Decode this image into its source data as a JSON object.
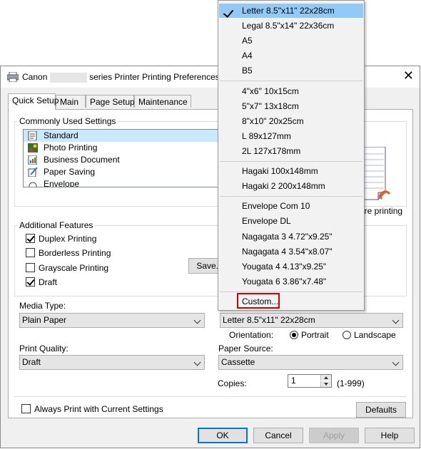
{
  "window": {
    "title_prefix": "Canon",
    "title_suffix": "series Printer Printing Preferences",
    "close": "✕"
  },
  "tabs": [
    "Quick Setup",
    "Main",
    "Page Setup",
    "Maintenance"
  ],
  "commonly_used": {
    "legend": "Commonly Used Settings",
    "items": [
      "Standard",
      "Photo Printing",
      "Business Document",
      "Paper Saving",
      "Envelope"
    ],
    "save_button": "Save..."
  },
  "preview": {
    "caption": "ore printing"
  },
  "additional": {
    "legend": "Additional Features",
    "items": [
      {
        "label": "Duplex Printing",
        "checked": true
      },
      {
        "label": "Borderless Printing",
        "checked": false
      },
      {
        "label": "Grayscale Printing",
        "checked": false
      },
      {
        "label": "Draft",
        "checked": true
      }
    ]
  },
  "media_type": {
    "label": "Media Type:",
    "value": "Plain Paper"
  },
  "page_size": {
    "value": "Letter 8.5\"x11\" 22x28cm"
  },
  "orientation": {
    "label": "Orientation:",
    "portrait": "Portrait",
    "landscape": "Landscape",
    "selected": "Portrait"
  },
  "print_quality": {
    "label": "Print Quality:",
    "value": "Draft"
  },
  "paper_source": {
    "label": "Paper Source:",
    "value": "Cassette"
  },
  "copies": {
    "label": "Copies:",
    "value": "1",
    "range": "(1-999)"
  },
  "always_print": {
    "label": "Always Print with Current Settings",
    "checked": false
  },
  "buttons": {
    "defaults": "Defaults",
    "ok": "OK",
    "cancel": "Cancel",
    "apply": "Apply",
    "help": "Help"
  },
  "dropdown": {
    "groups": [
      [
        "Letter 8.5\"x11\" 22x28cm",
        "Legal 8.5\"x14\" 22x36cm",
        "A5",
        "A4",
        "B5"
      ],
      [
        "4\"x6\" 10x15cm",
        "5\"x7\" 13x18cm",
        "8\"x10\" 20x25cm",
        "L 89x127mm",
        "2L 127x178mm"
      ],
      [
        "Hagaki 100x148mm",
        "Hagaki 2 200x148mm"
      ],
      [
        "Envelope Com 10",
        "Envelope DL",
        "Nagagata 3 4.72\"x9.25\"",
        "Nagagata 4 3.54\"x8.07\"",
        "Yougata 4 4.13\"x9.25\"",
        "Yougata 6 3.86\"x7.48\""
      ],
      [
        "Custom..."
      ]
    ],
    "selected": "Letter 8.5\"x11\" 22x28cm"
  },
  "colors": {
    "accent": "#0078d7",
    "menu_highlight": "#91c9f7",
    "custom_outline": "#d40000"
  }
}
